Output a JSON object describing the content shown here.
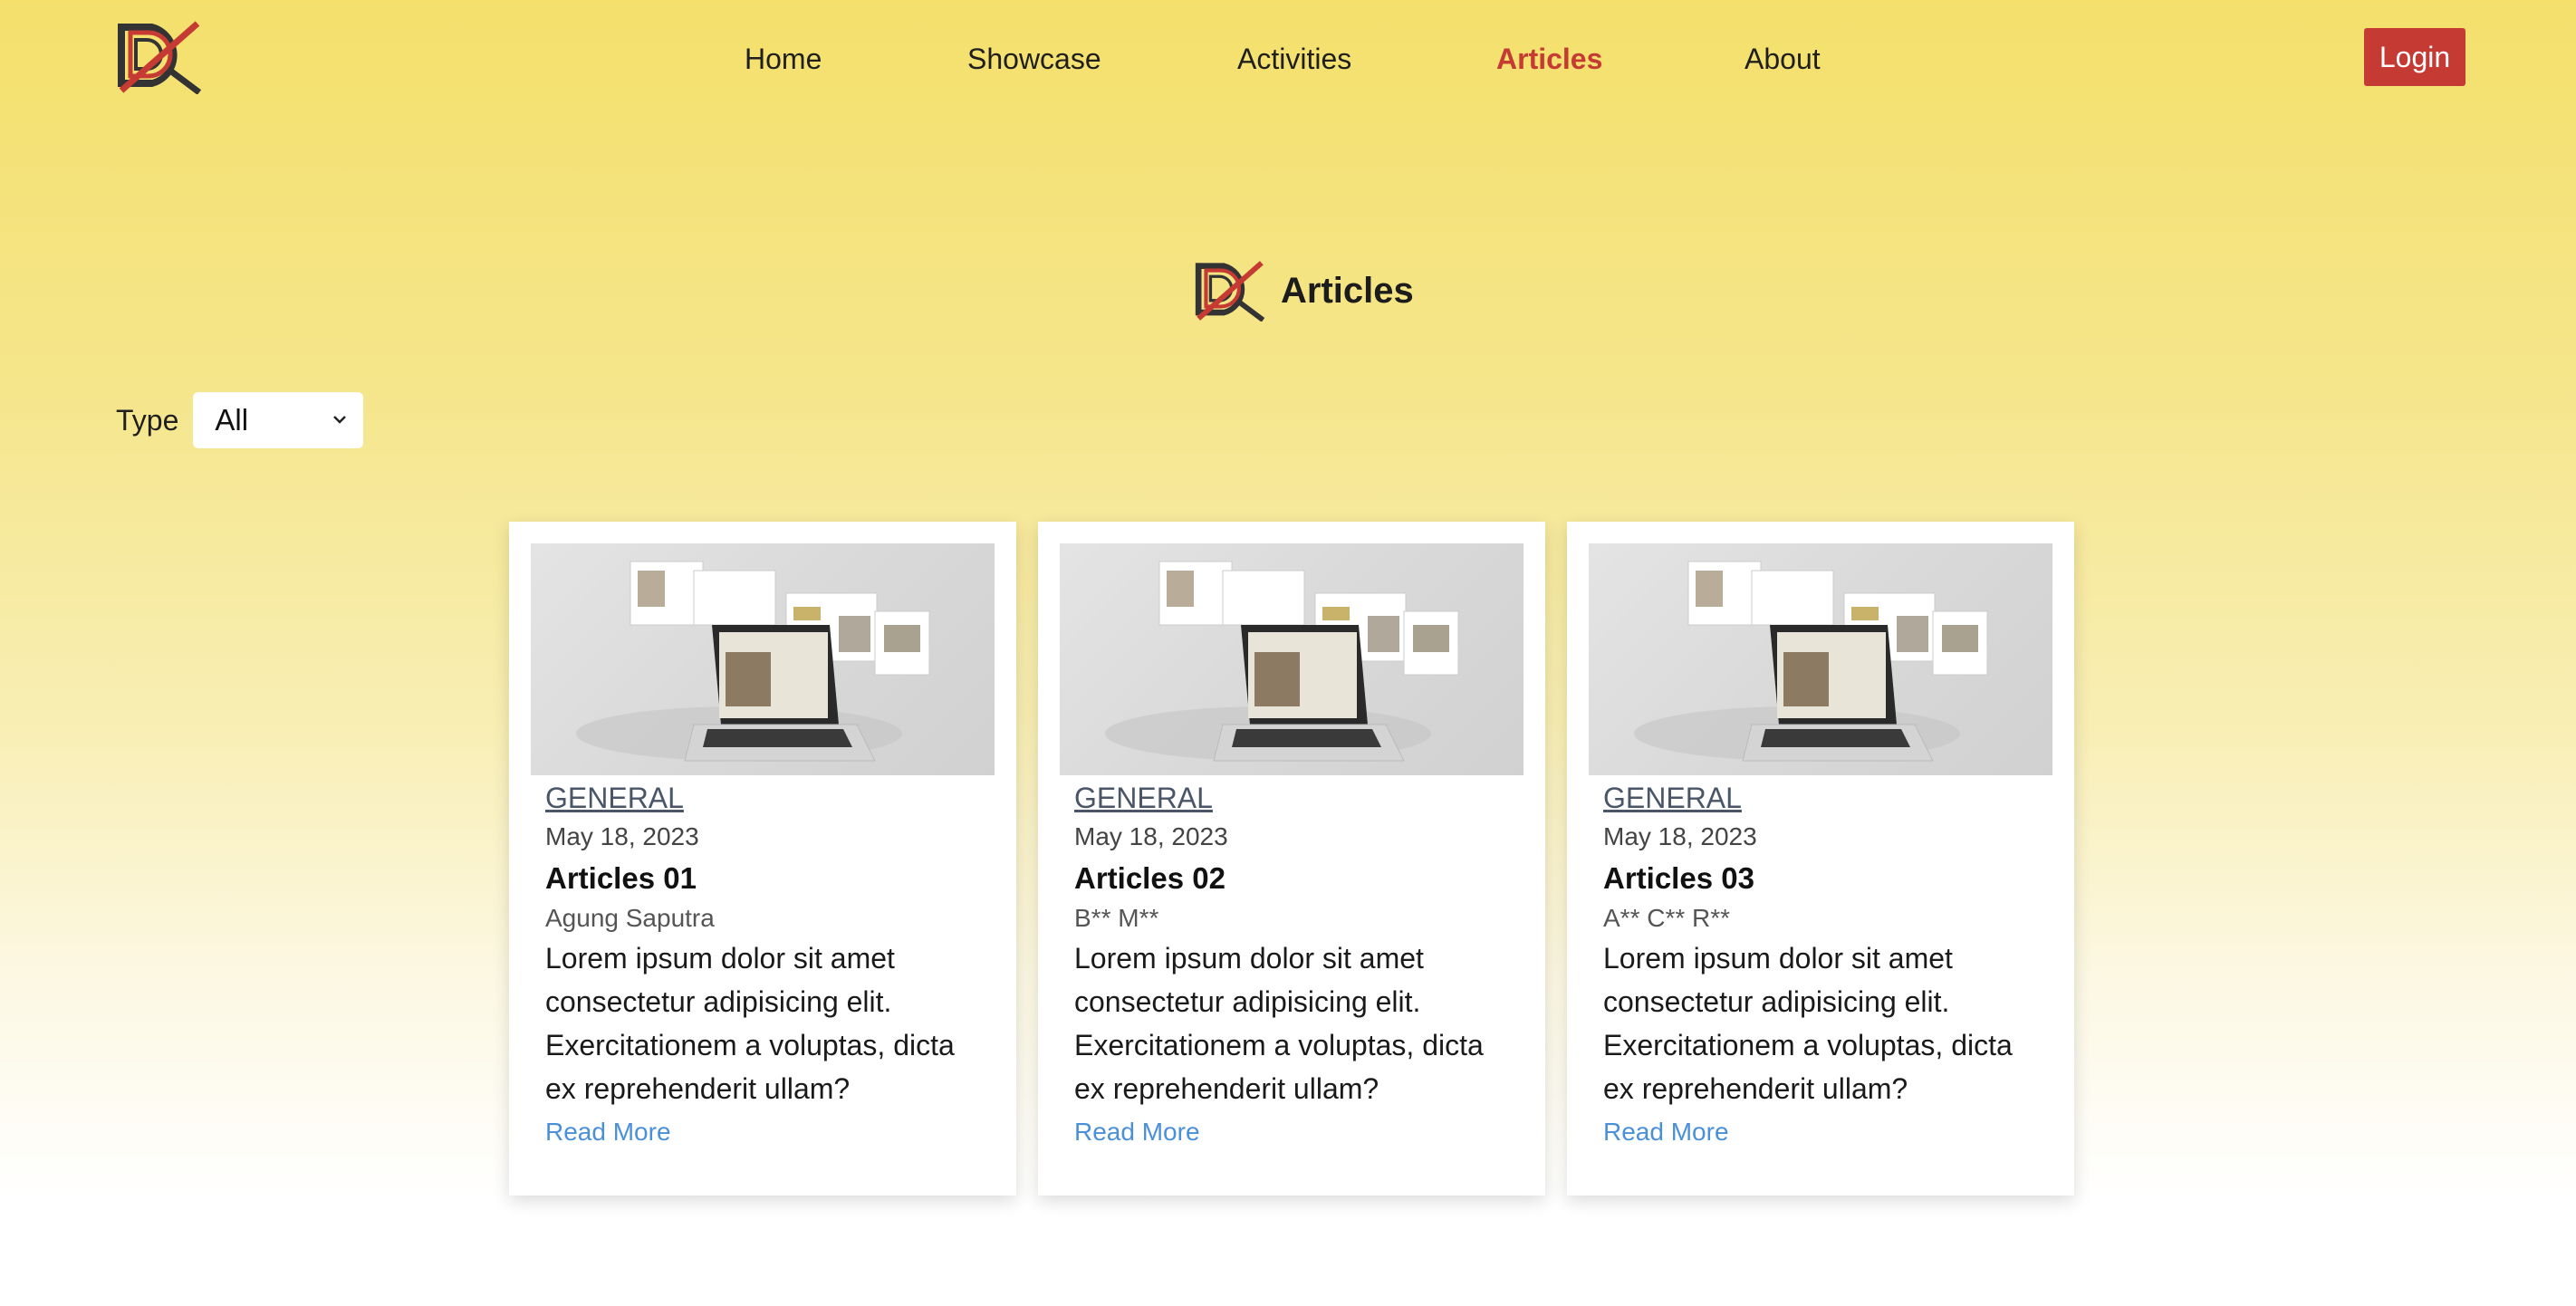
{
  "nav": {
    "items": [
      {
        "label": "Home",
        "active": false
      },
      {
        "label": "Showcase",
        "active": false
      },
      {
        "label": "Activities",
        "active": false
      },
      {
        "label": "Articles",
        "active": true
      },
      {
        "label": "About",
        "active": false
      }
    ],
    "login_label": "Login"
  },
  "section": {
    "heading": "Articles"
  },
  "filter": {
    "label": "Type",
    "selected": "All"
  },
  "articles": [
    {
      "category": "GENERAL",
      "date": "May 18, 2023",
      "title": "Articles 01",
      "author": "Agung Saputra",
      "excerpt": "Lorem ipsum dolor sit amet consectetur adipisicing elit. Exercitationem a voluptas, dicta ex reprehenderit ullam?",
      "read_more": "Read More"
    },
    {
      "category": "GENERAL",
      "date": "May 18, 2023",
      "title": "Articles 02",
      "author": "B** M**",
      "excerpt": "Lorem ipsum dolor sit amet consectetur adipisicing elit. Exercitationem a voluptas, dicta ex reprehenderit ullam?",
      "read_more": "Read More"
    },
    {
      "category": "GENERAL",
      "date": "May 18, 2023",
      "title": "Articles 03",
      "author": "A** C** R**",
      "excerpt": "Lorem ipsum dolor sit amet consectetur adipisicing elit. Exercitationem a voluptas, dicta ex reprehenderit ullam?",
      "read_more": "Read More"
    }
  ],
  "colors": {
    "accent": "#c63a34",
    "link": "#4a90d9",
    "header_yellow": "#f4e06b"
  },
  "icons": {
    "brand": "brand-logo-icon",
    "chevron": "chevron-down-icon"
  }
}
